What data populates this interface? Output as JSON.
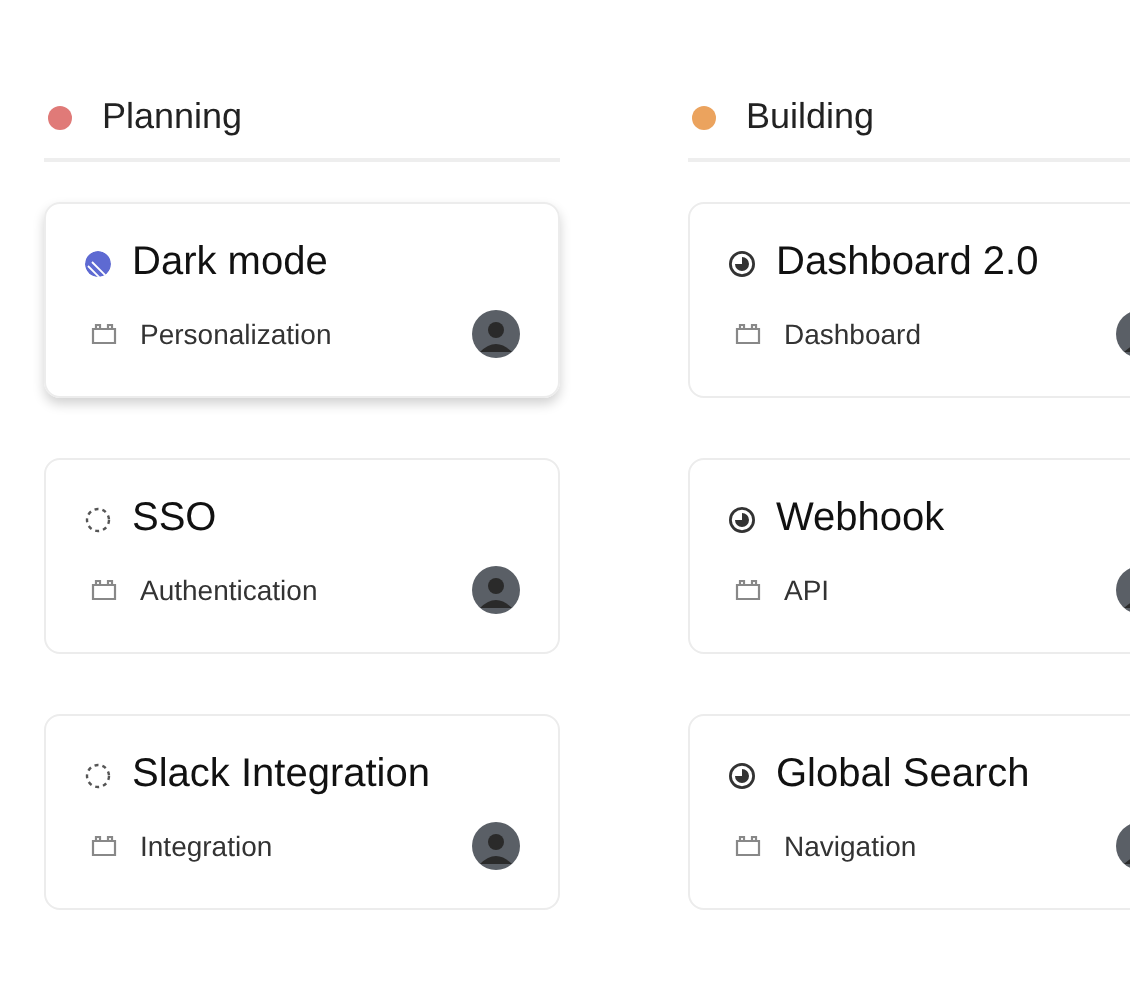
{
  "columns": [
    {
      "title": "Planning",
      "color": "#e07a78",
      "cards": [
        {
          "title": "Dark mode",
          "kind": "progress",
          "tag": "Personalization",
          "selected": true
        },
        {
          "title": "SSO",
          "kind": "backlog",
          "tag": "Authentication",
          "selected": false
        },
        {
          "title": "Slack Integration",
          "kind": "backlog",
          "tag": "Integration",
          "selected": false
        }
      ]
    },
    {
      "title": "Building",
      "color": "#eba35e",
      "cards": [
        {
          "title": "Dashboard 2.0",
          "kind": "building",
          "tag": "Dashboard",
          "selected": false
        },
        {
          "title": "Webhook",
          "kind": "building",
          "tag": "API",
          "selected": false
        },
        {
          "title": "Global Search",
          "kind": "building",
          "tag": "Navigation",
          "selected": false
        }
      ]
    }
  ]
}
